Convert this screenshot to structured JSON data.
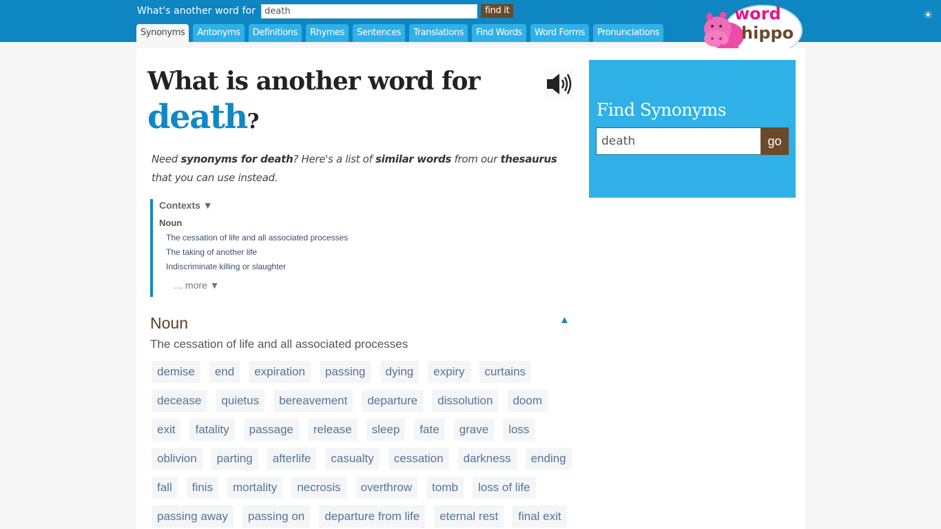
{
  "topbar": {
    "search_label": "What's another word for",
    "search_value": "death",
    "find_button": "find it",
    "tabs": [
      "Synonyms",
      "Antonyms",
      "Definitions",
      "Rhymes",
      "Sentences",
      "Translations",
      "Find Words",
      "Word Forms",
      "Pronunciations"
    ],
    "active_tab": "Synonyms",
    "logo_top": "word",
    "logo_bottom": "hippo",
    "theme_icon": "sun-icon"
  },
  "main": {
    "heading": "What is another word for",
    "word": "death",
    "question_mark": "?",
    "intro": {
      "p1": "Need ",
      "b1": "synonyms for death",
      "p2": "? Here's a list of ",
      "b2": "similar words",
      "p3": " from our ",
      "b3": "thesaurus",
      "p4": " that you can use instead."
    },
    "contexts": {
      "title": "Contexts ▼",
      "pos": "Noun",
      "items": [
        "The cessation of life and all associated processes",
        "The taking of another life",
        "Indiscriminate killing or slaughter"
      ],
      "more": "… more ▼"
    },
    "section": {
      "pos": "Noun",
      "collapse": "▲",
      "definition": "The cessation of life and all associated processes",
      "words": [
        "demise",
        "end",
        "expiration",
        "passing",
        "dying",
        "expiry",
        "curtains",
        "decease",
        "quietus",
        "bereavement",
        "departure",
        "dissolution",
        "doom",
        "exit",
        "fatality",
        "passage",
        "release",
        "sleep",
        "fate",
        "grave",
        "loss",
        "oblivion",
        "parting",
        "afterlife",
        "casualty",
        "cessation",
        "darkness",
        "ending",
        "fall",
        "finis",
        "mortality",
        "necrosis",
        "overthrow",
        "tomb",
        "loss of life",
        "passing away",
        "passing on",
        "departure from life",
        "eternal rest",
        "final exit"
      ]
    }
  },
  "sidebar": {
    "title": "Find Synonyms",
    "input_value": "death",
    "go_button": "go"
  },
  "colors": {
    "topbar": "#0e86c1",
    "tab": "#2fb1e8",
    "brown": "#6a4a2a",
    "accent": "#1188c3"
  }
}
